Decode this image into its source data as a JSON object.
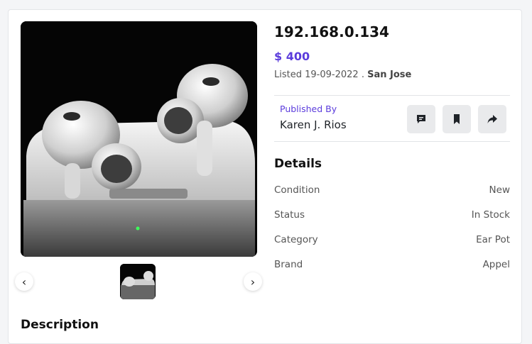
{
  "product": {
    "title": "192.168.0.134",
    "price": "$ 400",
    "listed_prefix": "Listed",
    "listed_date": "19-09-2022",
    "location": "San Jose"
  },
  "publisher": {
    "label": "Published By",
    "name": "Karen J. Rios"
  },
  "details": {
    "heading": "Details",
    "rows": [
      {
        "label": "Condition",
        "value": "New"
      },
      {
        "label": "Status",
        "value": "In Stock"
      },
      {
        "label": "Category",
        "value": "Ear Pot"
      },
      {
        "label": "Brand",
        "value": "Appel"
      }
    ]
  },
  "description": {
    "heading": "Description"
  },
  "icons": {
    "chat": "chat-icon",
    "bookmark": "bookmark-icon",
    "share": "share-icon",
    "prev": "chevron-left-icon",
    "next": "chevron-right-icon"
  },
  "colors": {
    "accent": "#5b3cdc"
  }
}
